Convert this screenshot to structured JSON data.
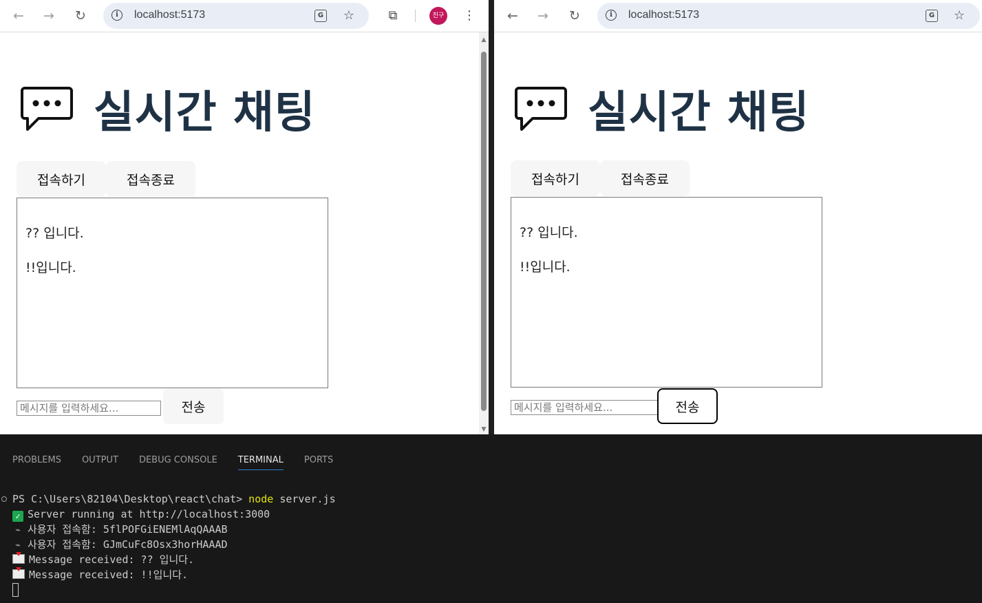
{
  "browser_left": {
    "url": "localhost:5173",
    "profile_label": "진구",
    "page": {
      "title": "실시간 채팅",
      "connect_label": "접속하기",
      "disconnect_label": "접속종료",
      "messages": [
        "?? 입니다.",
        "!!입니다."
      ],
      "input_placeholder": "메시지를 입력하세요...",
      "send_label": "전송"
    }
  },
  "browser_right": {
    "url": "localhost:5173",
    "page": {
      "title": "실시간 채팅",
      "connect_label": "접속하기",
      "disconnect_label": "접속종료",
      "messages": [
        "?? 입니다.",
        "!!입니다."
      ],
      "input_placeholder": "메시지를 입력하세요...",
      "send_label": "전송"
    }
  },
  "panel": {
    "tabs": [
      "PROBLEMS",
      "OUTPUT",
      "DEBUG CONSOLE",
      "TERMINAL",
      "PORTS"
    ],
    "active_tab": "TERMINAL",
    "terminal": {
      "prompt": "PS C:\\Users\\82104\\Desktop\\react\\chat> ",
      "command": "node",
      "args": " server.js",
      "lines": [
        "Server running at http://localhost:3000",
        "사용자 접속함: 5flPOFGiENEMlAqQAAAB",
        "사용자 접속함: GJmCuFc8Osx3horHAAAD",
        "Message received: ?? 입니다.",
        "Message received: !!입니다."
      ]
    }
  },
  "colors": {
    "title": "#1f3245",
    "omnibox": "#e9eef6",
    "terminal_bg": "#181818",
    "active_tab_underline": "#2f81d1",
    "avatar": "#c2185b"
  }
}
